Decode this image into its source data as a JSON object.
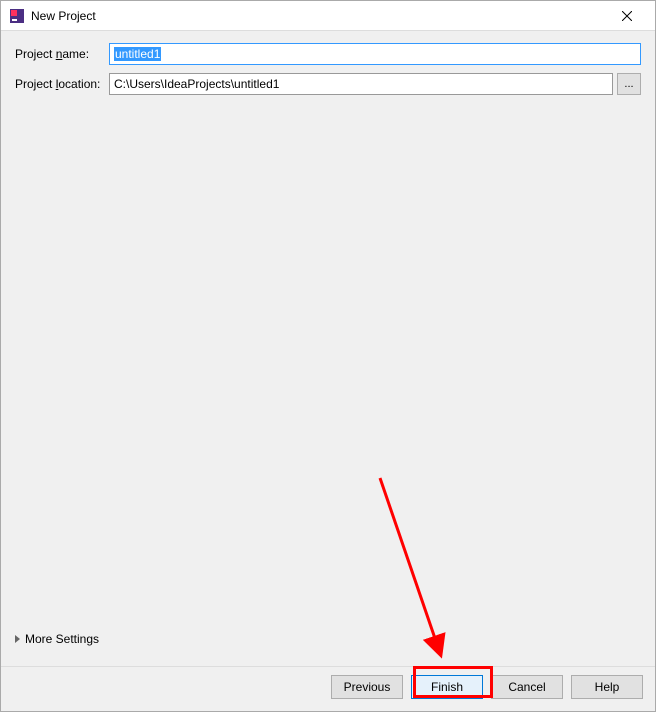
{
  "titlebar": {
    "title": "New Project",
    "icon_name": "intellij-icon"
  },
  "form": {
    "project_name_label_prefix": "Project ",
    "project_name_label_underline": "n",
    "project_name_label_suffix": "ame:",
    "project_name_value": "untitled1",
    "project_location_label_prefix": "Project ",
    "project_location_label_underline": "l",
    "project_location_label_suffix": "ocation:",
    "project_location_value": "C:\\Users\\IdeaProjects\\untitled1",
    "browse_btn_label": "..."
  },
  "more_settings": {
    "label": "More Settings"
  },
  "buttons": {
    "previous": "Previous",
    "finish": "Finish",
    "cancel": "Cancel",
    "help": "Help"
  },
  "annotation": {
    "highlight_target": "finish-button"
  }
}
